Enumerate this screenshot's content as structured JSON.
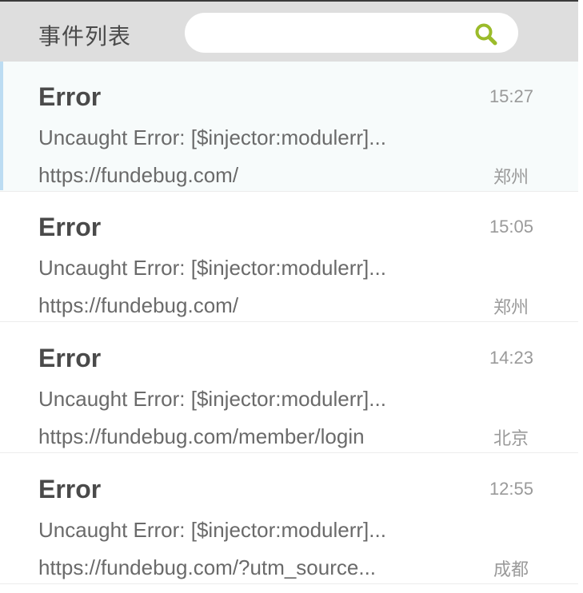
{
  "header": {
    "title": "事件列表",
    "search_placeholder": "",
    "search_value": "",
    "search_icon": "search-icon"
  },
  "colors": {
    "accent": "#9bbb2a",
    "header_bg": "#dedede",
    "active_bar": "#bcdcf2"
  },
  "events": [
    {
      "title": "Error",
      "time": "15:27",
      "message": "Uncaught Error: [$injector:modulerr]...",
      "url": "https://fundebug.com/",
      "city": "郑州",
      "active": true
    },
    {
      "title": "Error",
      "time": "15:05",
      "message": "Uncaught Error: [$injector:modulerr]...",
      "url": "https://fundebug.com/",
      "city": "郑州",
      "active": false
    },
    {
      "title": "Error",
      "time": "14:23",
      "message": "Uncaught Error: [$injector:modulerr]...",
      "url": "https://fundebug.com/member/login",
      "city": "北京",
      "active": false
    },
    {
      "title": "Error",
      "time": "12:55",
      "message": "Uncaught Error: [$injector:modulerr]...",
      "url": "https://fundebug.com/?utm_source...",
      "city": "成都",
      "active": false
    }
  ]
}
